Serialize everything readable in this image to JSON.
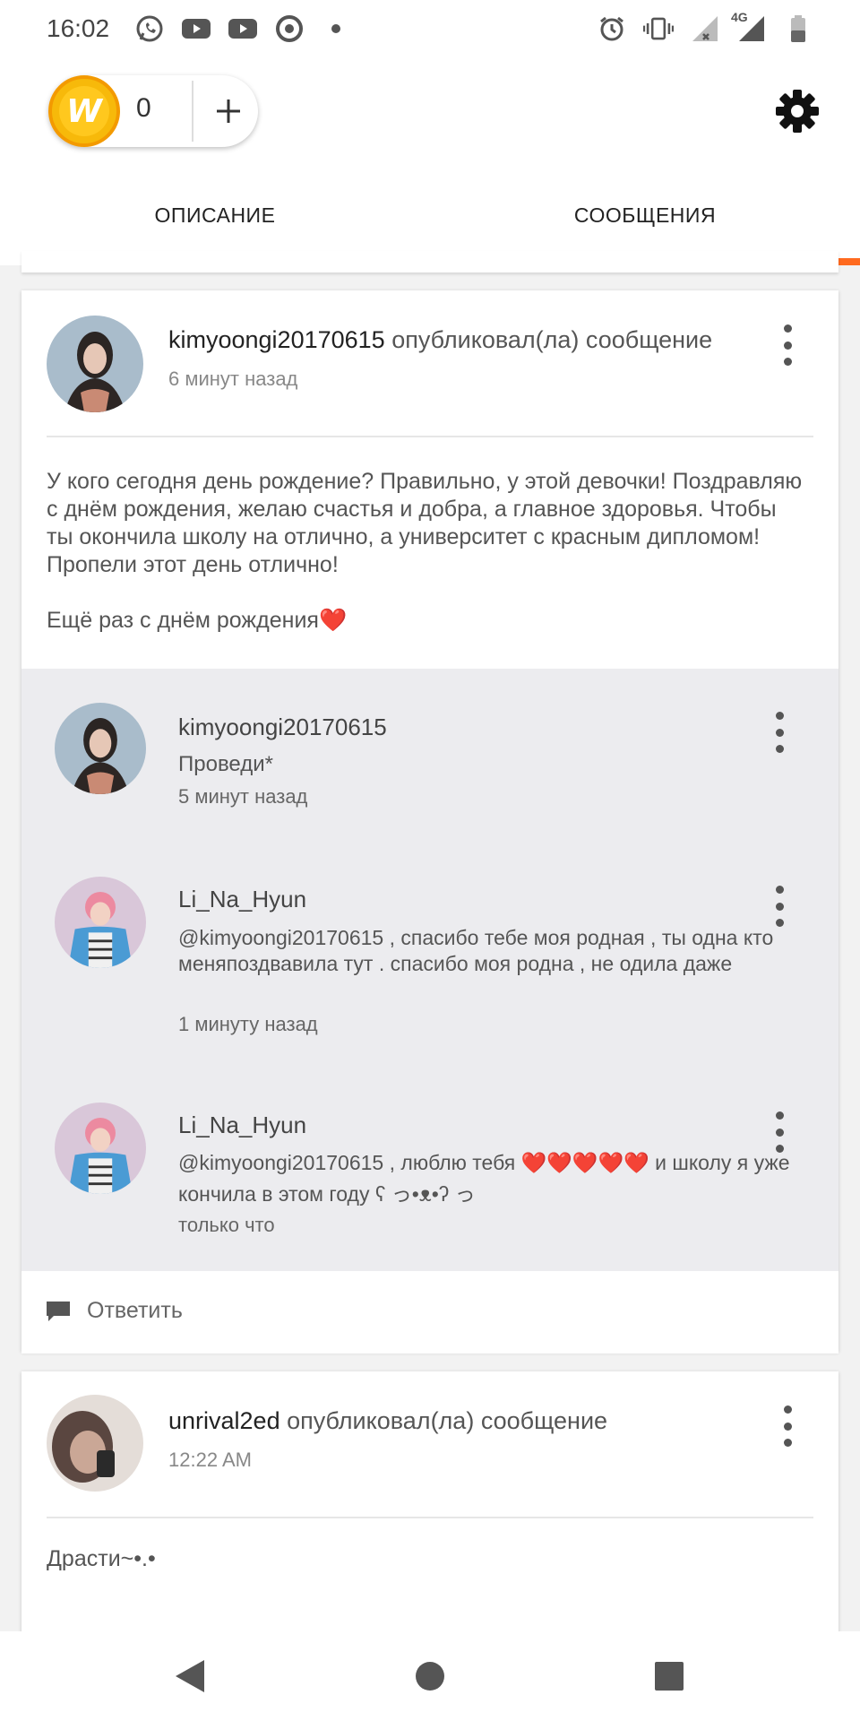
{
  "status_bar": {
    "time": "16:02",
    "left_icons": [
      "whatsapp-icon",
      "youtube-icon",
      "youtube-icon",
      "chrome-icon",
      "dot-icon"
    ],
    "right_icons": [
      "alarm-icon",
      "vibrate-icon",
      "signal-icon",
      "signal-4g-icon",
      "battery-icon"
    ],
    "network_label": "4G"
  },
  "top_bar": {
    "coin_glyph": "W",
    "coin_count": "0",
    "add_coins_glyph": "+",
    "settings_icon": "gear-icon",
    "accent_color": "#ff6a1f"
  },
  "tabs": [
    {
      "label": "ОПИСАНИЕ",
      "active": false
    },
    {
      "label": "СООБЩЕНИЯ",
      "active": true
    }
  ],
  "posts": [
    {
      "username": "kimyoongi20170615",
      "action": " опубликовал(ла) сообщение",
      "time": "6 минут назад",
      "body": "У кого сегодня день рождение? Правильно, у этой девочки! Поздравляю с днём рождения, желаю счастья и добра, а главное здоровья. Чтобы ты окончила школу на отлично, а университет с красным дипломом! Пропели этот день отлично!\n\nЕщё раз с днём рождения❤️",
      "comments": [
        {
          "username": "kimyoongi20170615",
          "text": "Проведи*",
          "time": "5 минут назад"
        },
        {
          "username": "Li_Na_Hyun",
          "text": "@kimyoongi20170615  , спасибо тебе моя родная , ты одна кто меняпоздвавила тут . спасибо моя родна , не одила даже",
          "time": "1 минуту назад"
        },
        {
          "username": "Li_Na_Hyun",
          "text": "@kimyoongi20170615  , люблю тебя ❤️❤️❤️❤️❤️ и школу я уже кончила в этом году ʕ っ•ᴥ•ʔ っ",
          "time": "только что"
        }
      ],
      "reply_label": "Ответить"
    },
    {
      "username": "unrival2ed",
      "action": " опубликовал(ла) сообщение",
      "time": "12:22 AM",
      "body": "Драсти~•.•"
    }
  ],
  "nav_bar": [
    "back-icon",
    "home-icon",
    "recents-icon"
  ]
}
